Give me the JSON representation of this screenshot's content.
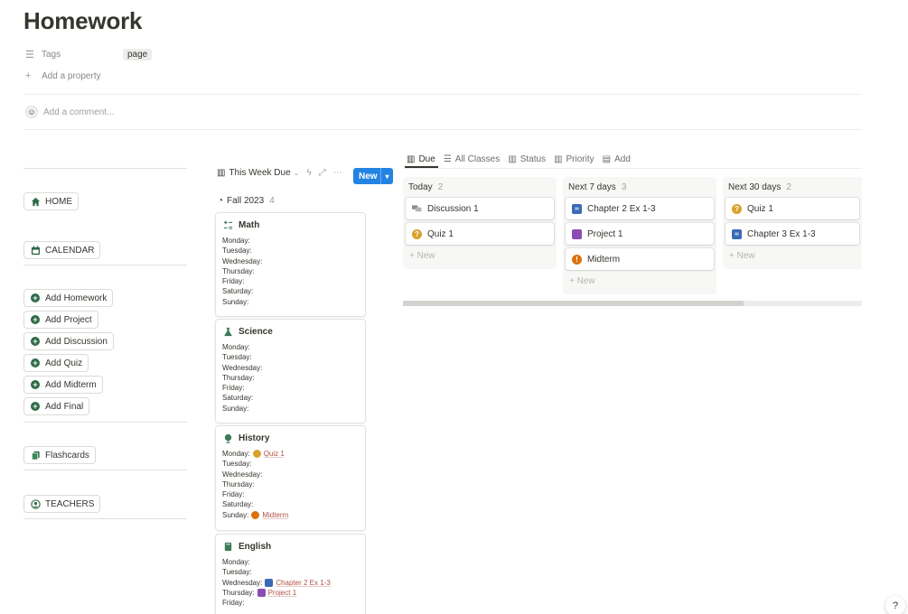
{
  "page": {
    "title": "Homework"
  },
  "properties": {
    "tags_label": "Tags",
    "tags_value": "page",
    "add_property": "Add a property"
  },
  "comment": {
    "placeholder": "Add a comment..."
  },
  "nav": {
    "home": "HOME",
    "calendar": "CALENDAR",
    "add_homework": "Add Homework",
    "add_project": "Add Project",
    "add_discussion": "Add Discussion",
    "add_quiz": "Add Quiz",
    "add_midterm": "Add Midterm",
    "add_final": "Add Final",
    "flashcards": "Flashcards",
    "teachers": "TEACHERS"
  },
  "classes_view": {
    "view_name": "This Week Due",
    "new_label": "New",
    "group_label": "Fall 2023",
    "group_count": "4",
    "classes": [
      {
        "name": "Math",
        "days": [
          {
            "day": "Monday:",
            "item": ""
          },
          {
            "day": "Tuesday:",
            "item": ""
          },
          {
            "day": "Wednesday:",
            "item": ""
          },
          {
            "day": "Thursday:",
            "item": ""
          },
          {
            "day": "Friday:",
            "item": ""
          },
          {
            "day": "Saturday:",
            "item": ""
          },
          {
            "day": "Sunday:",
            "item": ""
          }
        ]
      },
      {
        "name": "Science",
        "days": [
          {
            "day": "Monday:",
            "item": ""
          },
          {
            "day": "Tuesday:",
            "item": ""
          },
          {
            "day": "Wednesday:",
            "item": ""
          },
          {
            "day": "Thursday:",
            "item": ""
          },
          {
            "day": "Friday:",
            "item": ""
          },
          {
            "day": "Saturday:",
            "item": ""
          },
          {
            "day": "Sunday:",
            "item": ""
          }
        ]
      },
      {
        "name": "History",
        "days": [
          {
            "day": "Monday:",
            "item": "Quiz 1"
          },
          {
            "day": "Tuesday:",
            "item": ""
          },
          {
            "day": "Wednesday:",
            "item": ""
          },
          {
            "day": "Thursday:",
            "item": ""
          },
          {
            "day": "Friday:",
            "item": ""
          },
          {
            "day": "Saturday:",
            "item": ""
          },
          {
            "day": "Sunday:",
            "item": "Midterm"
          }
        ]
      },
      {
        "name": "English",
        "days": [
          {
            "day": "Monday:",
            "item": ""
          },
          {
            "day": "Tuesday:",
            "item": ""
          },
          {
            "day": "Wednesday:",
            "item": "Chapter 2 Ex 1-3"
          },
          {
            "day": "Thursday:",
            "item": "Project 1"
          },
          {
            "day": "Friday:",
            "item": ""
          }
        ]
      }
    ]
  },
  "board": {
    "tabs": [
      "Due",
      "All Classes",
      "Status",
      "Priority",
      "Add"
    ],
    "new_label": "New",
    "columns": [
      {
        "title": "Today",
        "count": "2",
        "cards": [
          {
            "title": "Discussion 1",
            "icon": "discussion-icon",
            "color": "#9b9a97"
          },
          {
            "title": "Quiz 1",
            "icon": "question-icon",
            "color": "#d9a22c"
          }
        ]
      },
      {
        "title": "Next 7 days",
        "count": "3",
        "cards": [
          {
            "title": "Chapter 2 Ex 1-3",
            "icon": "homework-icon",
            "color": "#3b6bb5"
          },
          {
            "title": "Project 1",
            "icon": "project-icon",
            "color": "#8a4db3"
          },
          {
            "title": "Midterm",
            "icon": "exclamation-icon",
            "color": "#d9730d"
          }
        ]
      },
      {
        "title": "Next 30 days",
        "count": "2",
        "cards": [
          {
            "title": "Quiz 1",
            "icon": "question-icon",
            "color": "#d9a22c"
          },
          {
            "title": "Chapter 3 Ex 1-3",
            "icon": "homework-icon",
            "color": "#3b6bb5"
          }
        ]
      }
    ]
  },
  "help": {
    "label": "?"
  }
}
